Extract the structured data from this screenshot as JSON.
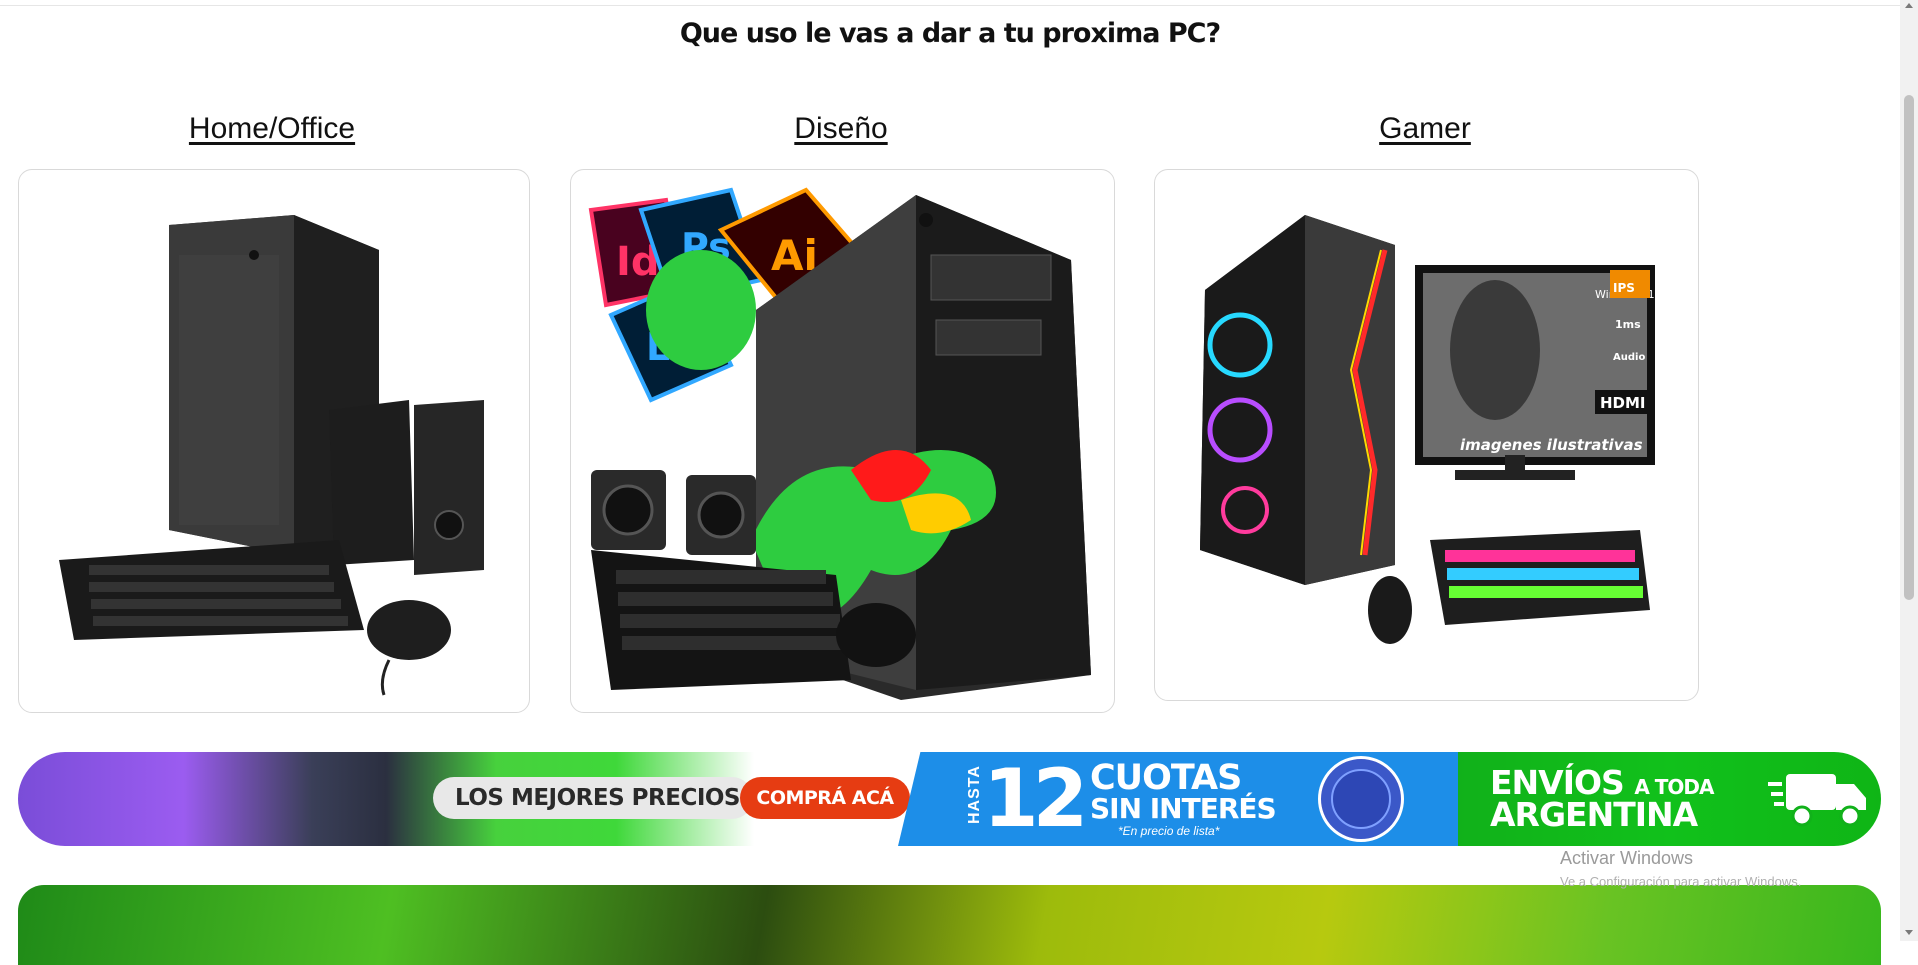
{
  "page": {
    "heading": "Que uso le vas a dar a tu proxima PC?"
  },
  "categories": [
    {
      "label": "Home/Office"
    },
    {
      "label": "Diseño"
    },
    {
      "label": "Gamer"
    }
  ],
  "promo_banner": {
    "best_prices": "LOS MEJORES PRECIOS",
    "buy_here": "COMPRÁ ACÁ",
    "hasta": "HASTA",
    "installments_number": "12",
    "installments_line1": "CUOTAS",
    "installments_line2": "SIN INTERÉS",
    "installments_note": "*En precio de lista*",
    "shipping_line1": "ENVÍOS",
    "shipping_small": "A TODA",
    "shipping_line2": "ARGENTINA"
  },
  "system": {
    "watermark_title": "Activar Windows",
    "watermark_sub": "Ve a Configuración para activar Windows."
  },
  "colors": {
    "banner_blue": "#1d8ee8",
    "banner_green": "#11b11a",
    "button_red": "#e63c12"
  },
  "icons": [
    "truck-icon",
    "coin-logo-icon"
  ]
}
